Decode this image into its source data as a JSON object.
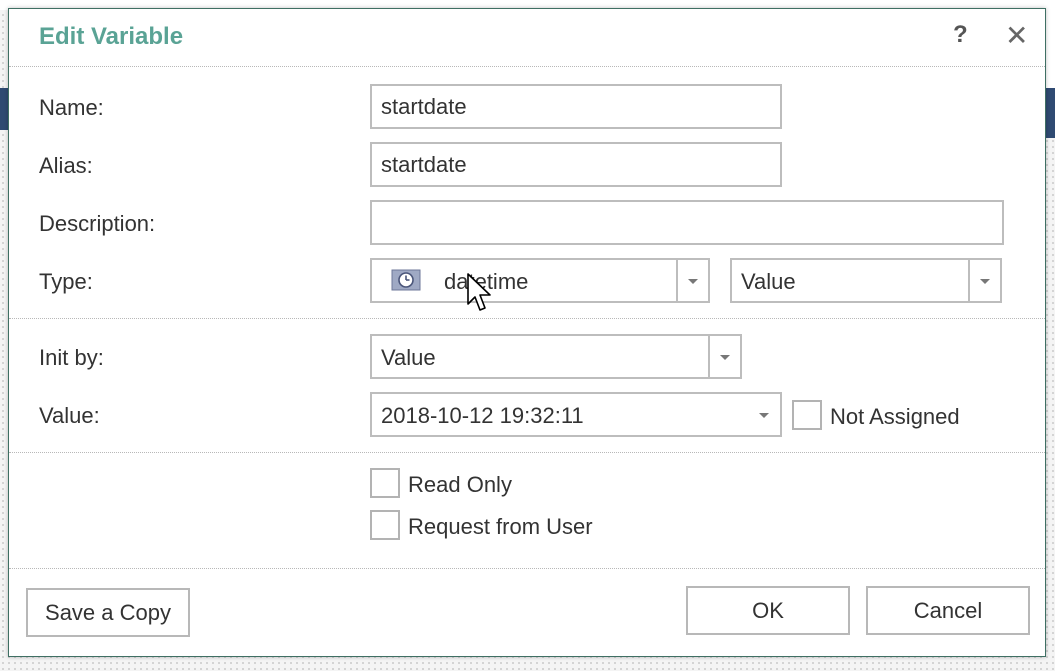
{
  "dialog": {
    "title": "Edit Variable",
    "help_icon": "question-mark-icon",
    "close_icon": "close-icon"
  },
  "fields": {
    "name_label": "Name:",
    "name_value": "startdate",
    "alias_label": "Alias:",
    "alias_value": "startdate",
    "description_label": "Description:",
    "description_value": "",
    "type_label": "Type:",
    "type_value": "datetime",
    "type_icon": "clock-icon",
    "type_mode_value": "Value",
    "init_by_label": "Init by:",
    "init_by_value": "Value",
    "value_label": "Value:",
    "value_value": "2018-10-12 19:32:11",
    "not_assigned_label": "Not Assigned"
  },
  "options": {
    "read_only_label": "Read Only",
    "request_from_user_label": "Request from User"
  },
  "buttons": {
    "save_copy_label": "Save a Copy",
    "ok_label": "OK",
    "cancel_label": "Cancel"
  },
  "colors": {
    "title": "#5aa395",
    "dialog_border": "#3f6f63",
    "background_bar": "#2f4a72"
  }
}
